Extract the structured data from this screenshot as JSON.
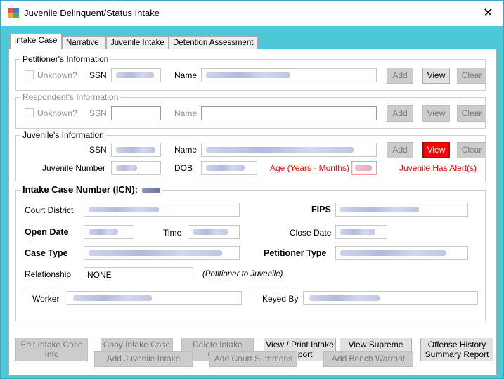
{
  "window": {
    "title": "Juvenile Delinquent/Status Intake",
    "close_glyph": "✕",
    "accent_color": "#4dc8d8",
    "alert_color": "#ff0000"
  },
  "tabs": [
    {
      "label": "Intake Case",
      "active": true
    },
    {
      "label": "Narrative",
      "active": false
    },
    {
      "label": "Juvenile Intake",
      "active": false
    },
    {
      "label": "Detention Assessment",
      "active": false
    }
  ],
  "petitioner": {
    "title": "Petitioner's Information",
    "unknown_label": "Unknown?",
    "ssn_label": "SSN",
    "name_label": "Name",
    "add": "Add",
    "view": "View",
    "clear": "Clear"
  },
  "respondent": {
    "title": "Respondent's Information",
    "unknown_label": "Unknown?",
    "ssn_label": "SSN",
    "name_label": "Name",
    "add": "Add",
    "view": "View",
    "clear": "Clear"
  },
  "juvenile": {
    "title": "Juvenile's Information",
    "ssn_label": "SSN",
    "name_label": "Name",
    "number_label": "Juvenile Number",
    "dob_label": "DOB",
    "age_label": "Age (Years - Months)",
    "alert_text": "Juvenile Has Alert(s)",
    "add": "Add",
    "view": "View",
    "clear": "Clear"
  },
  "intake_case": {
    "title": "Intake Case Number (ICN):",
    "court_district_label": "Court District",
    "fips_label": "FIPS",
    "open_date_label": "Open Date",
    "time_label": "Time",
    "close_date_label": "Close Date",
    "case_type_label": "Case Type",
    "petitioner_type_label": "Petitioner Type",
    "relationship_label": "Relationship",
    "relationship_value": "NONE",
    "relationship_note": "(Petitioner to Juvenile)",
    "worker_label": "Worker",
    "keyed_by_label": "Keyed By"
  },
  "actions": {
    "edit": "Edit Intake Case Info",
    "copy": "Copy Intake Case",
    "delete": "Delete Intake Case",
    "view_print": "View / Print Intake Report",
    "supreme": "View Supreme Court Details",
    "offense": "Offense History Summary Report",
    "add_juvenile_intake": "Add Juvenile Intake",
    "add_court_summons": "Add Court Summons",
    "add_bench_warrant": "Add Bench Warrant"
  }
}
